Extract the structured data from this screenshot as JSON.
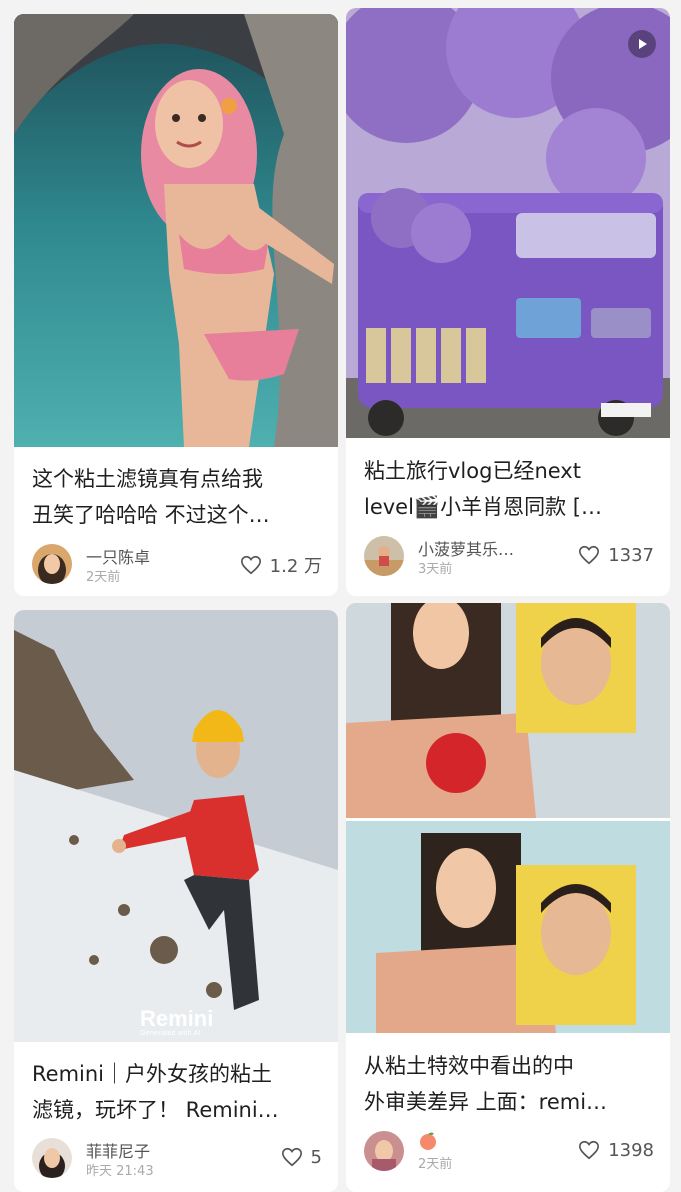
{
  "feed": {
    "cards": [
      {
        "title_lines": [
          "这个粘土滤镜真有点给我",
          "丑笑了哈哈哈 不过这个…"
        ],
        "author": "一只陈卓",
        "time": "2天前",
        "likes": "1.2 万",
        "image_icon": "clay-woman-bikini-photo"
      },
      {
        "title_lines": [
          "粘土旅行vlog已经next",
          "level🎬小羊肖恩同款 […"
        ],
        "author": "小菠萝其乐…",
        "time": "3天前",
        "likes": "1337",
        "image_icon": "clay-purple-bus-photo",
        "has_video": true
      },
      {
        "title_lines": [
          "Remini｜户外女孩的粘土",
          "滤镜，玩坏了！ Remini…"
        ],
        "author": "菲菲尼子",
        "time": "昨天 21:43",
        "likes": "5",
        "image_icon": "clay-climber-photo",
        "watermark": "Remini",
        "watermark_sub": "Generated with AI"
      },
      {
        "title_lines": [
          "从粘土特效中看出的中",
          "外审美差异 上面：remi…"
        ],
        "author": "",
        "time": "2天前",
        "likes": "1398",
        "image_icon": "clay-face-comparison-photo"
      }
    ]
  },
  "colors": {
    "background": "#f3f3f3",
    "card": "#ffffff",
    "text": "#1f1f1f",
    "muted": "#aaaaaa"
  },
  "icons": [
    "heart-icon",
    "play-icon",
    "peach-icon",
    "avatar"
  ]
}
